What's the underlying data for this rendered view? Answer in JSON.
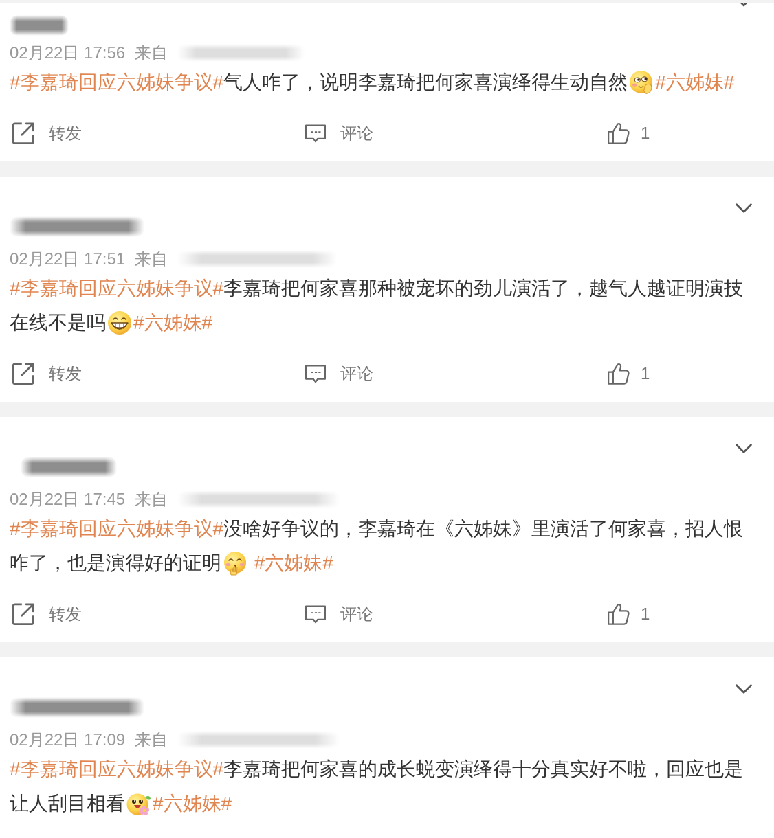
{
  "posts": [
    {
      "time": "02月22日 17:56",
      "source_label": "来自",
      "text": [
        {
          "kind": "hashtag",
          "text": "#李嘉琦回应六姊妹争议#"
        },
        {
          "kind": "text",
          "text": "气人咋了，说明李嘉琦把何家喜演绎得生动自然"
        },
        {
          "kind": "emoji"
        },
        {
          "kind": "hashtag",
          "text": "#六姊妹#"
        }
      ],
      "actions": {
        "repost": "转发",
        "comment": "评论",
        "likes": "1"
      }
    },
    {
      "time": "02月22日 17:51",
      "source_label": "来自",
      "text": [
        {
          "kind": "hashtag",
          "text": "#李嘉琦回应六姊妹争议#"
        },
        {
          "kind": "text",
          "text": "李嘉琦把何家喜那种被宠坏的劲儿演活了，越气人越证明演技在线不是吗"
        },
        {
          "kind": "emoji"
        },
        {
          "kind": "hashtag",
          "text": "#六姊妹#"
        }
      ],
      "actions": {
        "repost": "转发",
        "comment": "评论",
        "likes": "1"
      }
    },
    {
      "time": "02月22日 17:45",
      "source_label": "来自",
      "text": [
        {
          "kind": "hashtag",
          "text": "#李嘉琦回应六姊妹争议#"
        },
        {
          "kind": "text",
          "text": "没啥好争议的，李嘉琦在《六姊妹》里演活了何家喜，招人恨咋了，也是演得好的证明"
        },
        {
          "kind": "emoji"
        },
        {
          "kind": "hashtag",
          "text": " #六姊妹#"
        }
      ],
      "actions": {
        "repost": "转发",
        "comment": "评论",
        "likes": "1"
      }
    },
    {
      "time": "02月22日 17:09",
      "source_label": "来自",
      "text": [
        {
          "kind": "hashtag",
          "text": "#李嘉琦回应六姊妹争议#"
        },
        {
          "kind": "text",
          "text": "李嘉琦把何家喜的成长蜕变演绎得十分真实好不啦，回应也是让人刮目相看"
        },
        {
          "kind": "emoji"
        },
        {
          "kind": "hashtag",
          "text": "#六姊妹#"
        }
      ]
    }
  ]
}
